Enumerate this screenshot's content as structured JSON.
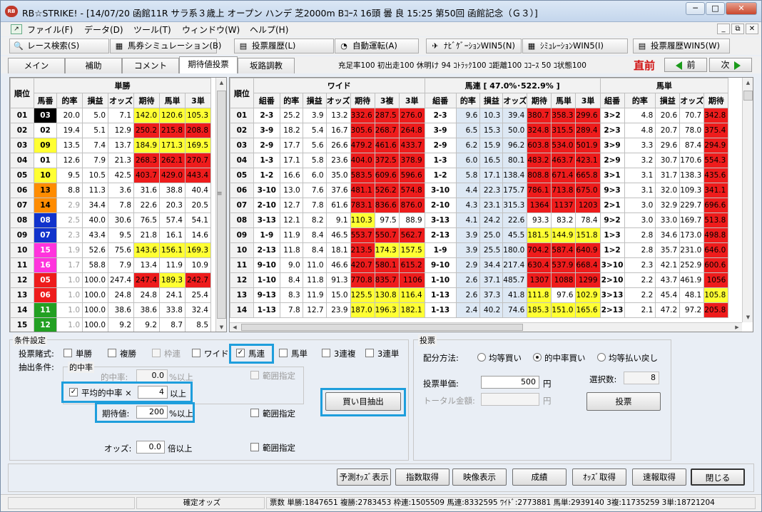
{
  "window": {
    "app_icon": "RB",
    "title": "RB☆STRIKE! - [14/07/20 函館11R サラ系３歳上 オープン ハンデ 芝2000m Bｺｰｽ 16頭 曇 良 15:25 第50回 函館記念（Ｇ３）]",
    "minimize": "─",
    "maximize": "□",
    "close": "✕"
  },
  "menu": {
    "items": [
      "ファイル(F)",
      "データ(D)",
      "ツール(T)",
      "ウィンドウ(W)",
      "ヘルプ(H)"
    ],
    "mdi": [
      "_",
      "⧉",
      "✕"
    ]
  },
  "toolbar": [
    {
      "label": "レース検索(S)",
      "icon": "magnifier-icon",
      "glyph": "🔍"
    },
    {
      "label": "馬券シミュレーション(B)",
      "icon": "table-icon",
      "glyph": "▦"
    },
    {
      "label": "投票履歴(L)",
      "icon": "document-icon",
      "glyph": "▤"
    },
    {
      "label": "自動運転(A)",
      "icon": "clock-icon",
      "glyph": "◔"
    },
    {
      "label": "ﾅﾋﾞｹﾞｰｼｮﾝWIN5(N)",
      "icon": "plane-icon",
      "glyph": "✈"
    },
    {
      "label": "ｼﾐｭﾚｰｼｮﾝWIN5(I)",
      "icon": "table-icon",
      "glyph": "▦"
    },
    {
      "label": "投票履歴WIN5(W)",
      "icon": "document-icon",
      "glyph": "▤"
    }
  ],
  "tabs": [
    "メイン",
    "補助",
    "コメント",
    "期待値投票",
    "坂路調教"
  ],
  "info": {
    "text": "充足率100 初出走100 休明け 94 ｺﾄﾗｯｸ100 ｺ距離100 ｺｺｰｽ 50 ｺ状態100",
    "chokuzen": "直前",
    "prev": "前",
    "next": "次"
  },
  "tansho": {
    "title": "単勝",
    "headers": [
      "順位",
      "馬番",
      "的率",
      "損益",
      "オッズ",
      "期待",
      "馬単",
      "3単"
    ],
    "rows": [
      [
        "01",
        "03",
        "20.0",
        "5.0",
        "7.1",
        "142.0",
        "120.6",
        "105.3"
      ],
      [
        "02",
        "02",
        "19.4",
        "5.1",
        "12.9",
        "250.2",
        "215.8",
        "208.8"
      ],
      [
        "03",
        "09",
        "13.5",
        "7.4",
        "13.7",
        "184.9",
        "171.3",
        "169.5"
      ],
      [
        "04",
        "01",
        "12.6",
        "7.9",
        "21.3",
        "268.3",
        "262.1",
        "270.7"
      ],
      [
        "05",
        "10",
        "9.5",
        "10.5",
        "42.5",
        "403.7",
        "429.0",
        "443.4"
      ],
      [
        "06",
        "13",
        "8.8",
        "11.3",
        "3.6",
        "31.6",
        "38.8",
        "40.4"
      ],
      [
        "07",
        "14",
        "2.9",
        "34.4",
        "7.8",
        "22.6",
        "20.3",
        "20.5"
      ],
      [
        "08",
        "08",
        "2.5",
        "40.0",
        "30.6",
        "76.5",
        "57.4",
        "54.1"
      ],
      [
        "09",
        "07",
        "2.3",
        "43.4",
        "9.5",
        "21.8",
        "16.1",
        "14.6"
      ],
      [
        "10",
        "15",
        "1.9",
        "52.6",
        "75.6",
        "143.6",
        "156.1",
        "169.3"
      ],
      [
        "11",
        "16",
        "1.7",
        "58.8",
        "7.9",
        "13.4",
        "11.9",
        "10.9"
      ],
      [
        "12",
        "05",
        "1.0",
        "100.0",
        "247.4",
        "247.4",
        "189.3",
        "242.7"
      ],
      [
        "13",
        "06",
        "1.0",
        "100.0",
        "24.8",
        "24.8",
        "24.1",
        "25.4"
      ],
      [
        "14",
        "11",
        "1.0",
        "100.0",
        "38.6",
        "38.6",
        "33.8",
        "32.4"
      ],
      [
        "15",
        "12",
        "1.0",
        "100.0",
        "9.2",
        "9.2",
        "8.7",
        "8.5"
      ]
    ]
  },
  "multi": {
    "rank_header": "順位",
    "wide_title": "ワイド",
    "umaren_title": "馬連 [ 47.0%･522.9% ]",
    "umatan_title": "馬単",
    "wide_headers": [
      "組番",
      "的率",
      "損益",
      "オッズ",
      "期待",
      "3複",
      "3単"
    ],
    "umaren_headers": [
      "組番",
      "的率",
      "損益",
      "オッズ",
      "期待",
      "馬単",
      "3単"
    ],
    "umatan_headers": [
      "組番",
      "的率",
      "損益",
      "オッズ",
      "期待"
    ],
    "ranks": [
      "01",
      "02",
      "03",
      "04",
      "05",
      "06",
      "07",
      "08",
      "09",
      "10",
      "11",
      "12",
      "13",
      "14"
    ],
    "wide": [
      [
        "2-3",
        "25.2",
        "3.9",
        "13.2",
        "332.6",
        "287.5",
        "276.0"
      ],
      [
        "3-9",
        "18.2",
        "5.4",
        "16.7",
        "305.6",
        "268.7",
        "264.8"
      ],
      [
        "2-9",
        "17.7",
        "5.6",
        "26.6",
        "479.2",
        "461.6",
        "433.7"
      ],
      [
        "1-3",
        "17.1",
        "5.8",
        "23.6",
        "404.0",
        "372.5",
        "378.9"
      ],
      [
        "1-2",
        "16.6",
        "6.0",
        "35.0",
        "583.5",
        "609.6",
        "596.6"
      ],
      [
        "3-10",
        "13.0",
        "7.6",
        "37.6",
        "481.1",
        "526.2",
        "574.8"
      ],
      [
        "2-10",
        "12.7",
        "7.8",
        "61.6",
        "783.1",
        "836.6",
        "876.0"
      ],
      [
        "3-13",
        "12.1",
        "8.2",
        "9.1",
        "110.3",
        "97.5",
        "88.9"
      ],
      [
        "1-9",
        "11.9",
        "8.4",
        "46.5",
        "553.7",
        "550.7",
        "562.7"
      ],
      [
        "2-13",
        "11.8",
        "8.4",
        "18.1",
        "213.5",
        "174.3",
        "157.5"
      ],
      [
        "9-10",
        "9.0",
        "11.0",
        "46.6",
        "420.7",
        "580.1",
        "615.2"
      ],
      [
        "1-10",
        "8.4",
        "11.8",
        "91.3",
        "770.8",
        "835.7",
        "1106"
      ],
      [
        "9-13",
        "8.3",
        "11.9",
        "15.0",
        "125.5",
        "130.8",
        "116.4"
      ],
      [
        "1-13",
        "7.8",
        "12.7",
        "23.9",
        "187.0",
        "196.3",
        "182.1"
      ]
    ],
    "umaren": [
      [
        "2-3",
        "9.6",
        "10.3",
        "39.4",
        "380.7",
        "358.3",
        "299.6"
      ],
      [
        "3-9",
        "6.5",
        "15.3",
        "50.0",
        "324.8",
        "315.5",
        "289.4"
      ],
      [
        "2-9",
        "6.2",
        "15.9",
        "96.2",
        "603.8",
        "534.0",
        "501.9"
      ],
      [
        "1-3",
        "6.0",
        "16.5",
        "80.1",
        "483.2",
        "463.7",
        "423.1"
      ],
      [
        "1-2",
        "5.8",
        "17.1",
        "138.4",
        "808.8",
        "671.4",
        "665.8"
      ],
      [
        "3-10",
        "4.4",
        "22.3",
        "175.7",
        "786.1",
        "713.8",
        "675.0"
      ],
      [
        "2-10",
        "4.3",
        "23.1",
        "315.3",
        "1364",
        "1137",
        "1203"
      ],
      [
        "3-13",
        "4.1",
        "24.2",
        "22.6",
        "93.3",
        "83.2",
        "78.4"
      ],
      [
        "2-13",
        "3.9",
        "25.0",
        "45.5",
        "181.5",
        "144.9",
        "151.8"
      ],
      [
        "1-9",
        "3.9",
        "25.5",
        "180.0",
        "704.2",
        "587.4",
        "640.9"
      ],
      [
        "9-10",
        "2.9",
        "34.4",
        "217.4",
        "630.4",
        "537.9",
        "668.4"
      ],
      [
        "1-10",
        "2.6",
        "37.1",
        "485.7",
        "1307",
        "1088",
        "1299"
      ],
      [
        "1-13",
        "2.6",
        "37.3",
        "41.8",
        "111.8",
        "97.6",
        "102.9"
      ],
      [
        "1-13",
        "2.4",
        "40.2",
        "74.6",
        "185.3",
        "151.0",
        "165.6"
      ]
    ],
    "umatan": [
      [
        "3>2",
        "4.8",
        "20.6",
        "70.7",
        "342.8"
      ],
      [
        "2>3",
        "4.8",
        "20.7",
        "78.0",
        "375.4"
      ],
      [
        "3>9",
        "3.3",
        "29.6",
        "87.4",
        "294.9"
      ],
      [
        "2>9",
        "3.2",
        "30.7",
        "170.6",
        "554.3"
      ],
      [
        "3>1",
        "3.1",
        "31.7",
        "138.3",
        "435.6"
      ],
      [
        "9>3",
        "3.1",
        "32.0",
        "109.3",
        "341.1"
      ],
      [
        "2>1",
        "3.0",
        "32.9",
        "229.7",
        "696.6"
      ],
      [
        "9>2",
        "3.0",
        "33.0",
        "169.7",
        "513.8"
      ],
      [
        "1>3",
        "2.8",
        "34.6",
        "173.0",
        "498.8"
      ],
      [
        "1>2",
        "2.8",
        "35.7",
        "231.0",
        "646.0"
      ],
      [
        "3>10",
        "2.3",
        "42.1",
        "252.9",
        "600.6"
      ],
      [
        "2>10",
        "2.2",
        "43.7",
        "461.9",
        "1056"
      ],
      [
        "3>13",
        "2.2",
        "45.4",
        "48.1",
        "105.8"
      ],
      [
        "2>13",
        "2.1",
        "47.2",
        "97.2",
        "205.8"
      ]
    ]
  },
  "conditions": {
    "title": "条件設定",
    "bet_type_label": "投票賭式:",
    "bet_types": [
      {
        "label": "単勝",
        "checked": false,
        "enabled": true
      },
      {
        "label": "複勝",
        "checked": false,
        "enabled": true
      },
      {
        "label": "枠連",
        "checked": false,
        "enabled": false
      },
      {
        "label": "ワイド",
        "checked": false,
        "enabled": true
      },
      {
        "label": "馬連",
        "checked": true,
        "enabled": true
      },
      {
        "label": "馬単",
        "checked": false,
        "enabled": true
      },
      {
        "label": "3連複",
        "checked": false,
        "enabled": true
      },
      {
        "label": "3連単",
        "checked": false,
        "enabled": true
      }
    ],
    "extract_label": "抽出条件:",
    "hit_group": "的中率",
    "hit_rate_label": "的中率:",
    "hit_rate_value": "0.0",
    "hit_rate_unit": "%以上",
    "range1": "範囲指定",
    "avg_label": "平均的中率 ×",
    "avg_value": "4",
    "avg_unit": "以上",
    "ev_label": "期待値:",
    "ev_value": "200",
    "ev_unit": "%以上",
    "range2": "範囲指定",
    "odds_label": "オッズ:",
    "odds_value": "0.0",
    "odds_unit": "倍以上",
    "range3": "範囲指定",
    "extract_button": "買い目抽出",
    "check": "✓"
  },
  "vote": {
    "title": "投票",
    "method_label": "配分方法:",
    "methods": [
      {
        "label": "均等買い",
        "selected": false
      },
      {
        "label": "的中率買い",
        "selected": true
      },
      {
        "label": "均等払い戻し",
        "selected": false
      }
    ],
    "unit_label": "投票単価:",
    "unit_value": "500",
    "yen": "円",
    "total_label": "トータル金額:",
    "total_value": "",
    "count_label": "選択数:",
    "count_value": "8",
    "vote_button": "投票"
  },
  "bottom_buttons": [
    "予測ｵｯｽﾞ表示",
    "指数取得",
    "映像表示",
    "成績",
    "ｵｯｽﾞ取得",
    "速報取得",
    "閉じる"
  ],
  "status": {
    "odds_type": "確定オッズ",
    "votes": "票数 単勝:1847651 複勝:2783453 枠連:1505509 馬連:8332595 ﾜｲﾄﾞ:2773881 馬単:2939140 3複:11735259 3単:18721204"
  },
  "colors": {
    "red": "#ee1c1c",
    "yellow": "#ffff33",
    "blue": "#dde8f4",
    "highlight": "#1e9edc"
  },
  "horse_colors": {
    "01": [
      "#ffffff",
      "#000000"
    ],
    "02": [
      "#ffffff",
      "#000000"
    ],
    "03": [
      "#000000",
      "#ffffff"
    ],
    "05": [
      "#ee1c1c",
      "#ffffff"
    ],
    "06": [
      "#ee1c1c",
      "#ffffff"
    ],
    "07": [
      "#1133cc",
      "#ffffff"
    ],
    "08": [
      "#1133cc",
      "#ffffff"
    ],
    "09": [
      "#ffff33",
      "#000000"
    ],
    "10": [
      "#ffff33",
      "#000000"
    ],
    "11": [
      "#22a022",
      "#ffffff"
    ],
    "12": [
      "#22a022",
      "#ffffff"
    ],
    "13": [
      "#ff8c00",
      "#000000"
    ],
    "14": [
      "#ff8c00",
      "#000000"
    ],
    "15": [
      "#ff33dd",
      "#ffffff"
    ],
    "16": [
      "#ff33dd",
      "#ffffff"
    ]
  }
}
